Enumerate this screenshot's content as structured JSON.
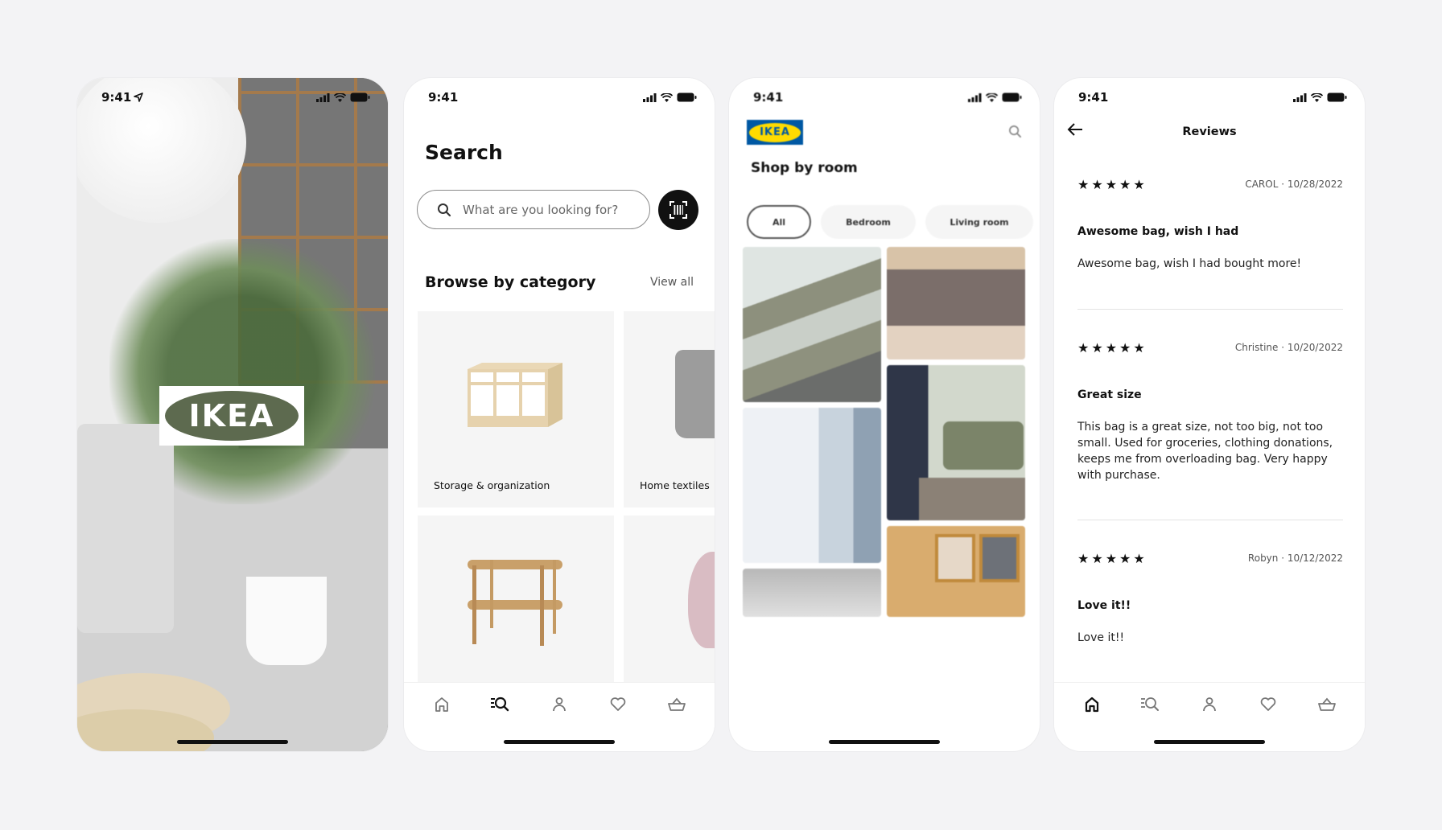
{
  "status_bar": {
    "time": "9:41"
  },
  "screen_splash": {
    "logo_text": "IKEA",
    "location_icon": "location-arrow-icon"
  },
  "screen_search": {
    "title": "Search",
    "search": {
      "placeholder": "What are you looking for?",
      "value": ""
    },
    "scan_icon": "barcode-scan-icon",
    "section_title": "Browse by category",
    "view_all": "View all",
    "categories": [
      {
        "label": "Storage & organization",
        "image": "storage-unit"
      },
      {
        "label": "Home textiles",
        "image": "throw-blanket"
      },
      {
        "label": "",
        "image": "console-table"
      },
      {
        "label": "",
        "image": "pink-vase"
      }
    ]
  },
  "screen_home": {
    "logo_text": "IKEA",
    "title": "Shop by room",
    "chips": [
      {
        "label": "All",
        "active": true
      },
      {
        "label": "Bedroom",
        "active": false
      },
      {
        "label": "Living room",
        "active": false
      }
    ],
    "images": [
      "painting-bench",
      "craft-organizer",
      "sheer-curtains",
      "folded-textiles",
      "picture-frames",
      "ceiling"
    ]
  },
  "screen_reviews": {
    "title": "Reviews",
    "reviews": [
      {
        "rating": 5,
        "author_date": "CAROL · 10/28/2022",
        "headline": "Awesome bag, wish I had",
        "body": "Awesome bag, wish I had bought more!"
      },
      {
        "rating": 5,
        "author_date": "Christine · 10/20/2022",
        "headline": "Great size",
        "body": "This bag is a great size, not too big, not too small. Used for groceries, clothing donations, keeps me from overloading bag. Very happy with purchase."
      },
      {
        "rating": 5,
        "author_date": "Robyn · 10/12/2022",
        "headline": "Love it!!",
        "body": "Love it!!"
      }
    ]
  },
  "bottom_nav": [
    {
      "name": "home",
      "icon": "home-icon"
    },
    {
      "name": "search",
      "icon": "search-list-icon"
    },
    {
      "name": "profile",
      "icon": "person-icon"
    },
    {
      "name": "favourites",
      "icon": "heart-icon"
    },
    {
      "name": "cart",
      "icon": "basket-icon"
    }
  ],
  "colors": {
    "ikea_blue": "#0058a3",
    "ikea_yellow": "#ffdb00",
    "background": "#f3f3f5",
    "tile_bg": "#f5f5f5"
  }
}
